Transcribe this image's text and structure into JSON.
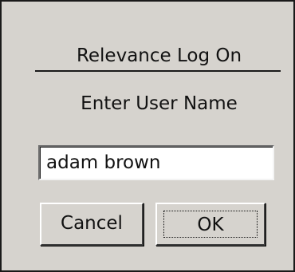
{
  "dialog": {
    "title": "Relevance Log On",
    "prompt": "Enter User Name",
    "username_value": "adam brown",
    "cancel_label": "Cancel",
    "ok_label": "OK"
  },
  "colors": {
    "background": "#d6d3ce",
    "border": "#1a1a1a",
    "input_background": "#ffffff",
    "text": "#111111"
  }
}
